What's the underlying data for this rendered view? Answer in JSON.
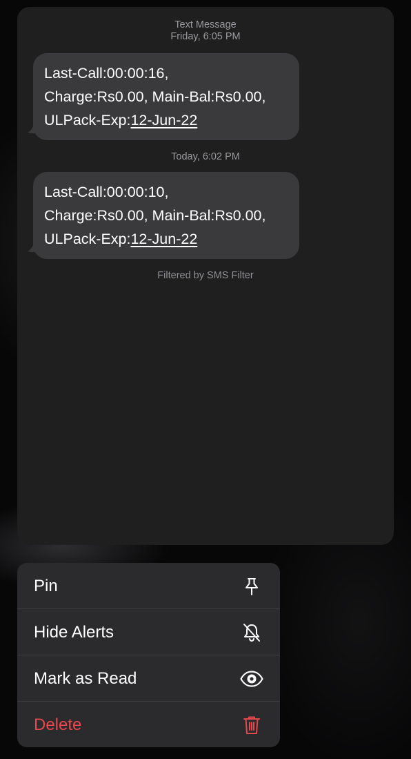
{
  "conversation": {
    "header_title": "Text Message",
    "header_time": "Friday, 6:05 PM",
    "messages": [
      {
        "line1": "Last-Call:00:00:16,",
        "line2": "Charge:Rs0.00, Main-Bal:Rs0.00,",
        "line3_prefix": "ULPack-Exp:",
        "line3_link": "12-Jun-22"
      },
      {
        "timestamp": "Today, 6:02 PM",
        "line1": "Last-Call:00:00:10,",
        "line2": "Charge:Rs0.00, Main-Bal:Rs0.00,",
        "line3_prefix": "ULPack-Exp:",
        "line3_link": "12-Jun-22"
      }
    ],
    "filter_note": "Filtered by SMS Filter"
  },
  "menu": {
    "items": [
      {
        "label": "Pin",
        "icon": "pin-icon"
      },
      {
        "label": "Hide Alerts",
        "icon": "bell-slash-icon"
      },
      {
        "label": "Mark as Read",
        "icon": "eye-icon"
      },
      {
        "label": "Delete",
        "icon": "trash-icon",
        "destructive": true
      }
    ]
  },
  "colors": {
    "bubble": "#3a3a3c",
    "card": "#1f1f20",
    "menu": "#2b2b2d",
    "destructive": "#e5484d"
  }
}
